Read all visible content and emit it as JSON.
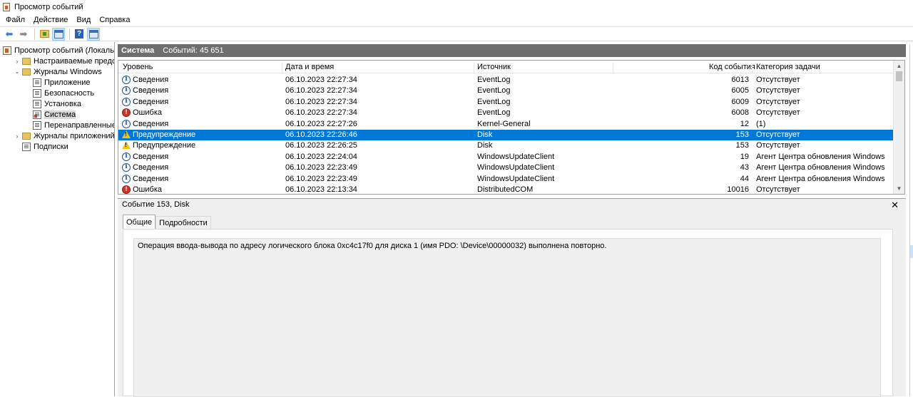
{
  "window": {
    "title": "Просмотр событий"
  },
  "menu": [
    "Файл",
    "Действие",
    "Вид",
    "Справка"
  ],
  "tree": [
    {
      "label": "Просмотр событий (Локальный)",
      "indent": 0,
      "icon": "viewer-icon",
      "expander": ""
    },
    {
      "label": "Настраиваемые представления",
      "indent": 1,
      "icon": "folder-icon",
      "expander": "›"
    },
    {
      "label": "Журналы Windows",
      "indent": 1,
      "icon": "folder-icon",
      "expander": "⌄"
    },
    {
      "label": "Приложение",
      "indent": 2,
      "icon": "log-icon",
      "expander": ""
    },
    {
      "label": "Безопасность",
      "indent": 2,
      "icon": "log-icon",
      "expander": ""
    },
    {
      "label": "Установка",
      "indent": 2,
      "icon": "log-icon",
      "expander": ""
    },
    {
      "label": "Система",
      "indent": 2,
      "icon": "log-icon",
      "expander": "",
      "selected": true
    },
    {
      "label": "Перенаправленные события",
      "indent": 2,
      "icon": "log-icon",
      "expander": ""
    },
    {
      "label": "Журналы приложений и служб",
      "indent": 1,
      "icon": "folder-icon",
      "expander": "›"
    },
    {
      "label": "Подписки",
      "indent": 1,
      "icon": "log-icon",
      "expander": ""
    }
  ],
  "grid": {
    "log_name": "Система",
    "event_count": "Событий: 45 651",
    "columns": {
      "level": "Уровень",
      "datetime": "Дата и время",
      "source": "Источник",
      "event_id": "Код события",
      "category": "Категория задачи"
    },
    "rows": [
      {
        "level": "Сведения",
        "type": "info",
        "datetime": "06.10.2023 22:27:34",
        "source": "EventLog",
        "event_id": "6013",
        "category": "Отсутствует"
      },
      {
        "level": "Сведения",
        "type": "info",
        "datetime": "06.10.2023 22:27:34",
        "source": "EventLog",
        "event_id": "6005",
        "category": "Отсутствует"
      },
      {
        "level": "Сведения",
        "type": "info",
        "datetime": "06.10.2023 22:27:34",
        "source": "EventLog",
        "event_id": "6009",
        "category": "Отсутствует"
      },
      {
        "level": "Ошибка",
        "type": "error",
        "datetime": "06.10.2023 22:27:34",
        "source": "EventLog",
        "event_id": "6008",
        "category": "Отсутствует"
      },
      {
        "level": "Сведения",
        "type": "info",
        "datetime": "06.10.2023 22:27:26",
        "source": "Kernel-General",
        "event_id": "12",
        "category": "(1)"
      },
      {
        "level": "Предупреждение",
        "type": "warning",
        "datetime": "06.10.2023 22:26:46",
        "source": "Disk",
        "event_id": "153",
        "category": "Отсутствует",
        "selected": true
      },
      {
        "level": "Предупреждение",
        "type": "warning",
        "datetime": "06.10.2023 22:26:25",
        "source": "Disk",
        "event_id": "153",
        "category": "Отсутствует"
      },
      {
        "level": "Сведения",
        "type": "info",
        "datetime": "06.10.2023 22:24:04",
        "source": "WindowsUpdateClient",
        "event_id": "19",
        "category": "Агент Центра обновления Windows"
      },
      {
        "level": "Сведения",
        "type": "info",
        "datetime": "06.10.2023 22:23:49",
        "source": "WindowsUpdateClient",
        "event_id": "43",
        "category": "Агент Центра обновления Windows"
      },
      {
        "level": "Сведения",
        "type": "info",
        "datetime": "06.10.2023 22:23:49",
        "source": "WindowsUpdateClient",
        "event_id": "44",
        "category": "Агент Центра обновления Windows"
      },
      {
        "level": "Ошибка",
        "type": "error",
        "datetime": "06.10.2023 22:13:34",
        "source": "DistributedCOM",
        "event_id": "10016",
        "category": "Отсутствует"
      }
    ]
  },
  "detail": {
    "title": "Событие 153, Disk",
    "close": "✕",
    "tabs": [
      "Общие",
      "Подробности"
    ],
    "active_tab": 0,
    "description": "Операция ввода-вывода по адресу логического блока 0xc4c17f0 для диска 1 (имя PDO: \\Device\\00000032) выполнена повторно."
  },
  "colors": {
    "selection": "#0078d7",
    "header_bar": "#6e6e6e"
  }
}
